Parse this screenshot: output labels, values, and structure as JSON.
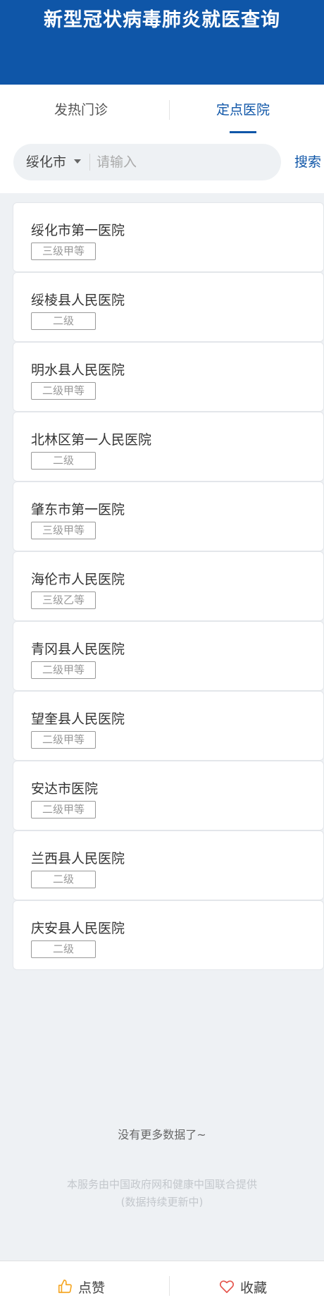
{
  "header": {
    "title": "新型冠状病毒肺炎就医查询"
  },
  "tabs": [
    {
      "label": "发热门诊",
      "active": false
    },
    {
      "label": "定点医院",
      "active": true
    }
  ],
  "search": {
    "city": "绥化市",
    "placeholder": "请输入",
    "value": "",
    "button_label": "搜索"
  },
  "hospitals": [
    {
      "name": "绥化市第一医院",
      "level": "三级甲等"
    },
    {
      "name": "绥棱县人民医院",
      "level": "二级"
    },
    {
      "name": "明水县人民医院",
      "level": "二级甲等"
    },
    {
      "name": "北林区第一人民医院",
      "level": "二级"
    },
    {
      "name": "肇东市第一医院",
      "level": "三级甲等"
    },
    {
      "name": "海伦市人民医院",
      "level": "三级乙等"
    },
    {
      "name": "青冈县人民医院",
      "level": "二级甲等"
    },
    {
      "name": "望奎县人民医院",
      "level": "二级甲等"
    },
    {
      "name": "安达市医院",
      "level": "二级甲等"
    },
    {
      "name": "兰西县人民医院",
      "level": "二级"
    },
    {
      "name": "庆安县人民医院",
      "level": "二级"
    }
  ],
  "list_end_text": "没有更多数据了~",
  "footer": {
    "line1": "本服务由中国政府网和健康中国联合提供",
    "line2": "(数据持续更新中)"
  },
  "bottom_bar": {
    "like_label": "点赞",
    "like_icon": "thumbs-up-icon",
    "favorite_label": "收藏",
    "favorite_icon": "heart-icon"
  },
  "colors": {
    "primary": "#0f56a8",
    "background": "#eef1f4",
    "like_icon": "#f5a623",
    "favorite_icon": "#e5534b"
  }
}
